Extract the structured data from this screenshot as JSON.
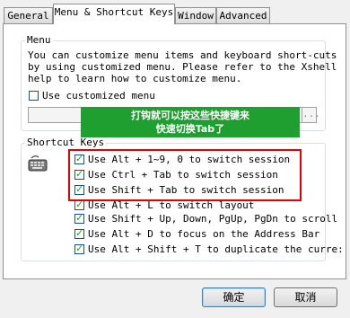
{
  "tabs": [
    {
      "label": "General"
    },
    {
      "label": "Menu & Shortcut Keys"
    },
    {
      "label": "Window"
    },
    {
      "label": "Advanced"
    }
  ],
  "menu_group": {
    "title": "Menu",
    "description_lines": [
      "You can customize menu items and keyboard short-cuts",
      "by using customized menu. Please refer to the Xshell",
      "help to learn how to customize menu."
    ],
    "use_customized_menu_label": "Use customized menu",
    "browse_label": "..."
  },
  "tooltip": {
    "line1": "打钩就可以按这些快捷键来",
    "line2": "快速切换Tab了"
  },
  "shortcut_group": {
    "title": "Shortcut Keys",
    "icon": "keyboard-icon",
    "items": [
      {
        "label": "Use Alt + 1~9, 0 to switch session"
      },
      {
        "label": "Use Ctrl + Tab to switch session"
      },
      {
        "label": "Use Shift + Tab to switch session"
      },
      {
        "label": "Use Alt + L to switch layout"
      },
      {
        "label": "Use Shift + Up, Down, PgUp, PgDn to scroll"
      },
      {
        "label": "Use Alt + D to focus on the Address Bar"
      },
      {
        "label": "Use Alt + Shift + T to duplicate the curre:"
      }
    ]
  },
  "buttons": {
    "ok": "确定",
    "cancel": "取消"
  }
}
